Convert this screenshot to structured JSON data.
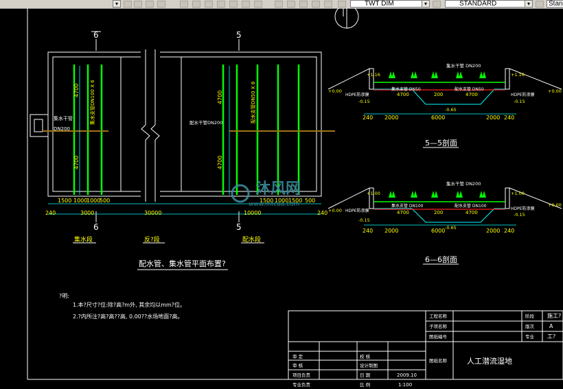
{
  "toolbar": {
    "dimstyle_value": "TWT DIM",
    "textstyle_value": "STANDARD",
    "extra_value": "Stan"
  },
  "drawing": {
    "plan": {
      "section6_label": "6",
      "section5_label": "5",
      "section6_label_bottom": "6",
      "section5_label_bottom": "5",
      "collect_segment": "集水段",
      "reaction_segment": "反?段",
      "distribute_segment": "配水段",
      "title": "配水管、集水管平面布置?",
      "inlet_pipe_1": "集水干管",
      "inlet_pipe_2": "DN200",
      "collect_branch": "集水支管DN100 X 6",
      "distribute_branch": "配水支管DN50 X 8",
      "distribute_main": "配水干管DN200",
      "dim_4700a": "4700",
      "dim_4700b": "4700",
      "dim_4700c": "4700",
      "dim_4700d": "4700",
      "dims_row1": [
        "1500",
        "1000",
        "1000",
        "500",
        "1500",
        "1000",
        "1500",
        "500"
      ],
      "dims_row2": [
        "240",
        "3000",
        "30000",
        "10000",
        "240"
      ]
    },
    "notes": {
      "heading": "?明:",
      "line1": "1.本?尺寸?位:除?高?m外, 其余均以mm?位。",
      "line2": "2.?内所注?高?高??高, 0.00??水场地面?高。"
    },
    "section55": {
      "title": "5—5剖面",
      "pipe_label": "集水干管 DN200",
      "elev_top_left": "+1.16",
      "elev_top_right": "+1.16",
      "elev_mid_left": "+0.00",
      "elev_mid_right": "+0.00",
      "elev_low_left": "-0.15",
      "elev_low_right": "-0.15",
      "elev_bottom": "-0.65",
      "left_pipe": "HDPE防渗膜",
      "right_pipe": "HDPE防渗膜",
      "pipe_dn50a": "集水支管 DN50",
      "pipe_dn50b": "配水支管 DN50",
      "dim_4700a": "4700",
      "dim_200": "200",
      "dim_4700b": "4700",
      "dims_bottom": [
        "240",
        "2000",
        "6000",
        "2000",
        "240"
      ]
    },
    "section66": {
      "title": "6—6剖面",
      "pipe_label": "集水干管 DN200",
      "elev_top_left": "+1.00",
      "elev_top_right": "+1.00",
      "elev_mid_left": "+0.00",
      "elev_mid_right": "+0.00",
      "elev_low_left": "-0.15",
      "elev_low_right": "-0.15",
      "elev_bottom": "-0.65",
      "left_pipe": "HDPE防渗膜",
      "right_pipe": "HDPE防渗膜",
      "pipe_dn100a": "集水支管 DN100",
      "pipe_dn100b": "配水支管 DN100",
      "dim_4700a": "4700",
      "dim_200": "200",
      "dim_4700b": "4700",
      "dims_bottom": [
        "240",
        "2000",
        "6000",
        "2000",
        "240"
      ]
    },
    "watermark": {
      "text": "沐风网",
      "url": "www.mfcad.com"
    },
    "titleblock": {
      "r1_label": "工程名称",
      "r2_label": "子项名称",
      "r3_label": "图纸编号",
      "r1_right_label": "阶段",
      "r1_right_value": "施工?",
      "r2_right_label": "版次",
      "r2_right_value": "A",
      "r3_right_label": "专业",
      "r3_right_value": "工?",
      "drawing_name_label": "图纸名称",
      "drawing_name_value": "人工潜流湿地",
      "sig1": "审 定",
      "sig2": "审 核",
      "sig3": "项目负责",
      "sig4": "专业负责",
      "sig5": "校 核",
      "sig6": "设计制图",
      "sig7": "日 期",
      "sig8": "比 例",
      "date_value": "2009.10",
      "scale_value": "1:100"
    }
  },
  "colors": {
    "frame": "#ffffff",
    "pipe_green": "#00ff00",
    "pipe_red": "#ff2020",
    "dim_cyan": "#00ffff",
    "label_yellow": "#ffff00",
    "text_white": "#ffffff",
    "watermark": "#3a8a9a"
  }
}
